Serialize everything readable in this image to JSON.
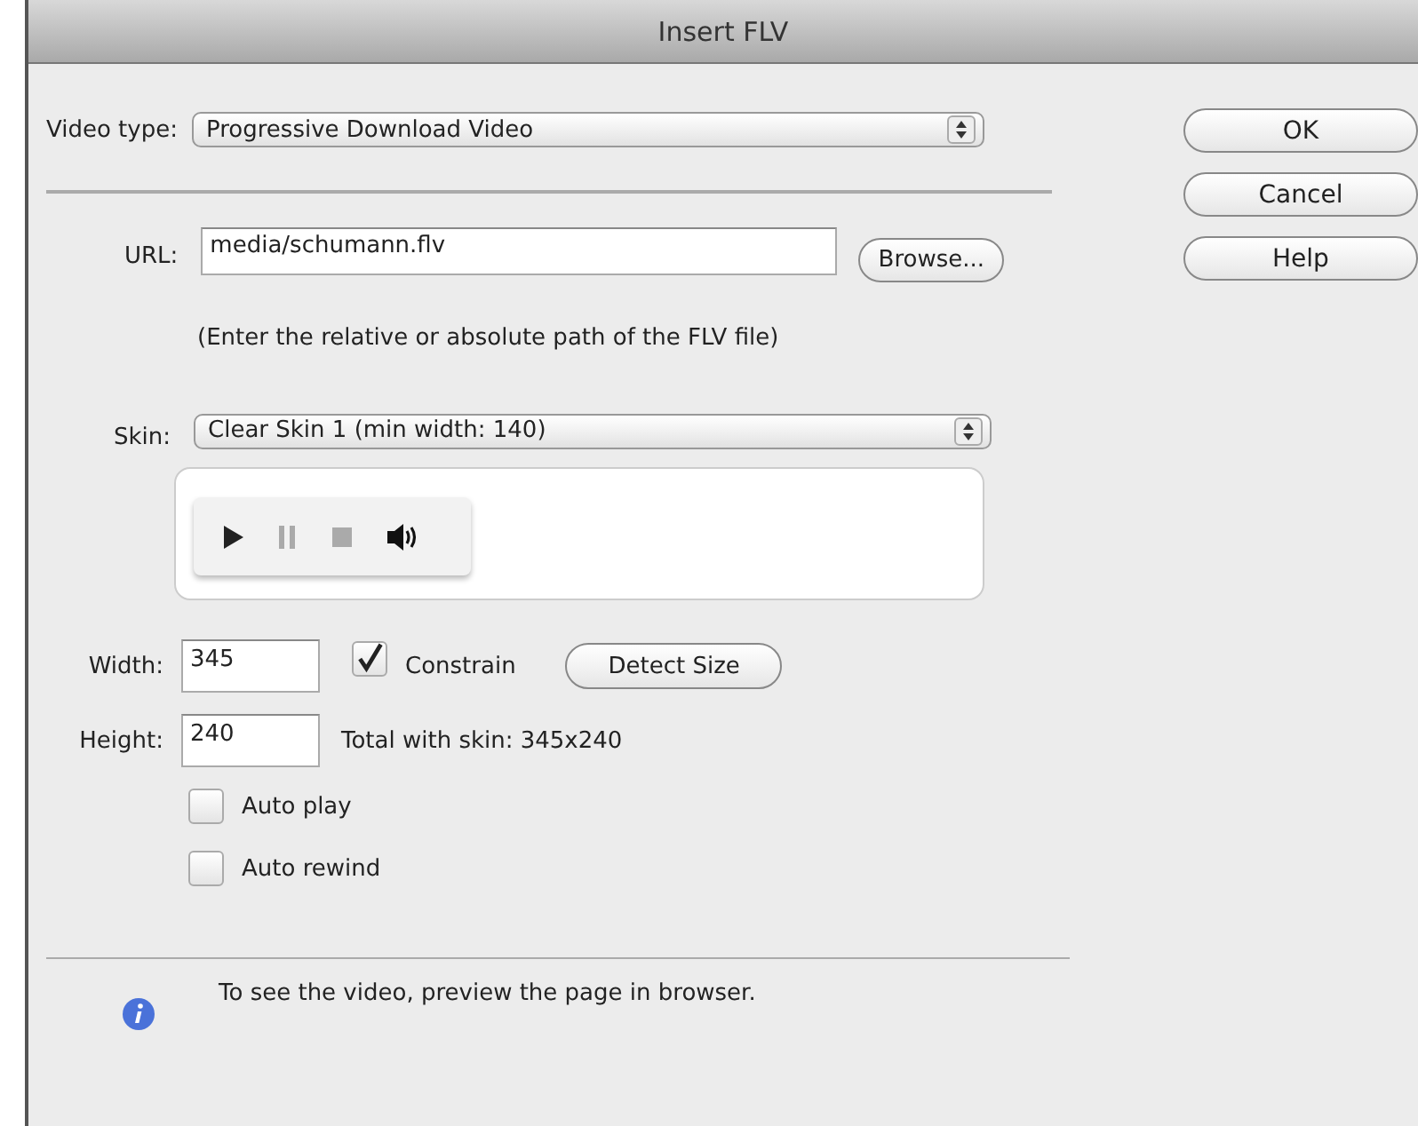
{
  "window": {
    "title": "Insert FLV"
  },
  "video_type": {
    "label": "Video type:",
    "value": "Progressive Download Video"
  },
  "url": {
    "label": "URL:",
    "value": "media/schumann.flv",
    "browse_button": "Browse...",
    "hint": "(Enter the relative or absolute path of the FLV file)"
  },
  "skin": {
    "label": "Skin:",
    "value": "Clear Skin 1 (min width: 140)"
  },
  "width": {
    "label": "Width:",
    "value": "345"
  },
  "constrain": {
    "label": "Constrain",
    "checked": true
  },
  "detect_button": "Detect Size",
  "height": {
    "label": "Height:",
    "value": "240"
  },
  "total": "Total with skin: 345x240",
  "options": [
    {
      "label": "Auto play",
      "checked": false
    },
    {
      "label": "Auto rewind",
      "checked": false
    }
  ],
  "info": "To see the video, preview the page in browser.",
  "buttons": [
    "OK",
    "Cancel",
    "Help"
  ]
}
